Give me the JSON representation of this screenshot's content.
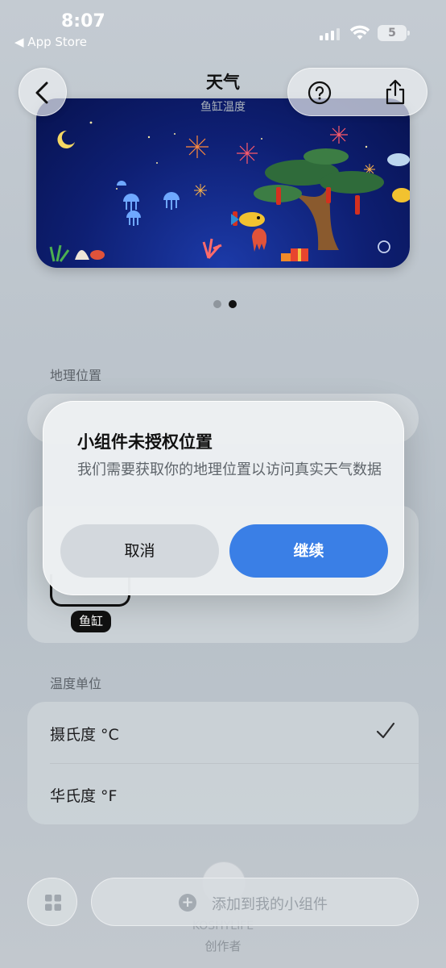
{
  "status_bar": {
    "time": "8:07",
    "back_app": "◀ App Store",
    "battery": "5"
  },
  "header": {
    "title": "天气",
    "subtitle": "鱼缸温度"
  },
  "widget": {
    "page_count": 2,
    "current_page": 2
  },
  "location": {
    "label": "地理位置"
  },
  "style": {
    "selected_tag": "鱼缸"
  },
  "temperature_unit": {
    "label": "温度单位",
    "options": [
      {
        "label": "摄氏度 °C",
        "selected": true
      },
      {
        "label": "华氏度 °F",
        "selected": false
      }
    ]
  },
  "creator": {
    "name": "KOSHYLIFE",
    "label": "创作者"
  },
  "footer": {
    "add_label": "添加到我的小组件",
    "add_icon": "plus-icon",
    "grid_icon": "grid-icon"
  },
  "dialog": {
    "title": "小组件未授权位置",
    "message": "我们需要获取你的地理位置以访问真实天气数据",
    "cancel_label": "取消",
    "continue_label": "继续"
  },
  "colors": {
    "accent": "#3a7fe6",
    "widget_bg": "#0e1f73"
  }
}
